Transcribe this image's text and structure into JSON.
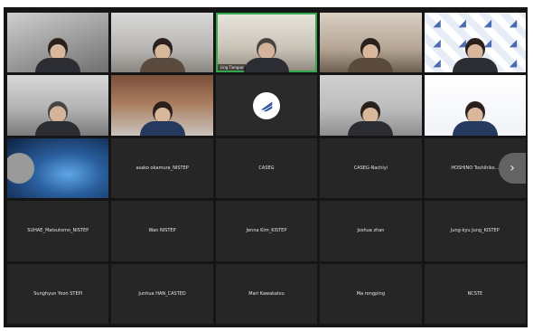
{
  "meeting": {
    "tiles": [
      {
        "id": "r1c1",
        "name": "",
        "video": true
      },
      {
        "id": "r1c2",
        "name": "",
        "video": true
      },
      {
        "id": "r1c3",
        "name": "Ling Tianguo",
        "video": true,
        "active": true
      },
      {
        "id": "r1c4",
        "name": "",
        "video": true
      },
      {
        "id": "r1c5",
        "name": "",
        "video": true
      },
      {
        "id": "r2c1",
        "name": "",
        "video": true
      },
      {
        "id": "r2c2",
        "name": "",
        "video": true
      },
      {
        "id": "r2c3",
        "name": "",
        "video": false,
        "logo": true
      },
      {
        "id": "r2c4",
        "name": "",
        "video": true
      },
      {
        "id": "r2c5",
        "name": "",
        "video": true
      },
      {
        "id": "r3c1",
        "name": "",
        "video": true
      },
      {
        "id": "r3c2",
        "name": "asako okamura_NISTEP"
      },
      {
        "id": "r3c3",
        "name": "CASEG"
      },
      {
        "id": "r3c4",
        "name": "CASEG-Nachiyi"
      },
      {
        "id": "r3c5",
        "name": "HOSHINO Toshihiko..."
      },
      {
        "id": "r4c1",
        "name": "SUHAE_Matsutomo_NISTEP"
      },
      {
        "id": "r4c2",
        "name": "Wan NISTEP"
      },
      {
        "id": "r4c3",
        "name": "Jenna Kim_KISTEP"
      },
      {
        "id": "r4c4",
        "name": "Joshua zhan"
      },
      {
        "id": "r4c5",
        "name": "Jung-kyu Jung_KISTEP"
      },
      {
        "id": "r5c1",
        "name": "Sunghyun Yoon STEPI"
      },
      {
        "id": "r5c2",
        "name": "Junhua HAN_CASTED"
      },
      {
        "id": "r5c3",
        "name": "Mari Kawakatsu"
      },
      {
        "id": "r5c4",
        "name": "Ma rongping"
      },
      {
        "id": "r5c5",
        "name": "NCSTE"
      }
    ],
    "next_page_label": "›",
    "colors": {
      "active_border": "#2fa84f",
      "tile_bg": "#262626",
      "logo_blue": "#2f55a4"
    }
  }
}
